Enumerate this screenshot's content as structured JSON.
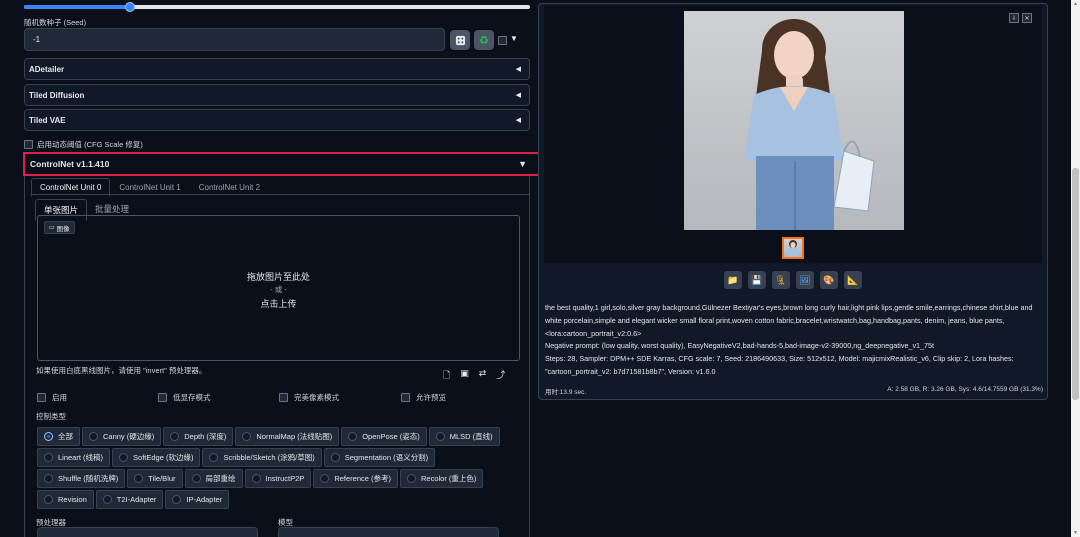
{
  "slider": {
    "fraction": 0.21
  },
  "seed": {
    "label": "随机数种子 (Seed)",
    "value": "-1",
    "dice_icon": "dice-icon",
    "recycle_icon": "recycle-icon",
    "extra_caret": "▼"
  },
  "accordions": [
    {
      "label": "ADetailer",
      "caret": "◀"
    },
    {
      "label": "Tiled Diffusion",
      "caret": "◀"
    },
    {
      "label": "Tiled VAE",
      "caret": "◀"
    }
  ],
  "dynamic_threshold": {
    "label": "启用动态阈值 (CFG Scale 修复)"
  },
  "controlnet": {
    "title": "ControlNet v1.1.410",
    "caret": "▼",
    "highlight_color": "#e11d48",
    "tabs": [
      "ControlNet Unit 0",
      "ControlNet Unit 1",
      "ControlNet Unit 2"
    ],
    "subtabs": [
      "单张图片",
      "批量处理"
    ],
    "image_badge": "图像",
    "drop_main": "拖放图片至此处",
    "drop_or": "- 或 -",
    "drop_upload": "点击上传",
    "hint": "如果使用白底黑线图片，请使用 \"invert\" 预处理器。",
    "options": [
      "启用",
      "低显存模式",
      "完美像素模式",
      "允许预览"
    ],
    "control_type_label": "控制类型",
    "control_types": [
      [
        "全部",
        "Canny (硬边缘)",
        "Depth (深度)",
        "NormalMap (法线贴图)",
        "OpenPose (姿态)",
        "MLSD (直线)"
      ],
      [
        "Lineart (线稿)",
        "SoftEdge (软边缘)",
        "Scribble/Sketch (涂鸦/草图)",
        "Segmentation (语义分割)"
      ],
      [
        "Shuffle (随机洗牌)",
        "Tile/Blur",
        "局部重绘",
        "InstructP2P",
        "Reference (参考)",
        "Recolor (重上色)"
      ],
      [
        "Revision",
        "T2I-Adapter",
        "IP-Adapter"
      ]
    ],
    "selected_control_type": "全部",
    "preprocessor_label": "预处理器",
    "model_label": "模型"
  },
  "output": {
    "prompt": "the best quality,1 girl,solo,silver gray background,Gülnezer Bextiyar's eyes,brown long curly hair,light pink lips,gentle smile,earrings,chinese shirt,blue and white porcelain,simple and elegant wicker small floral print,woven cotton fabric,bracelet,wristwatch,bag,handbag,pants, denim, jeans, blue pants, <lora:cartoon_portrait_v2:0.6>",
    "negative": "Negative prompt: (low quality, worst quality), EasyNegativeV2,bad-hands-5,bad-image-v2-39000,ng_deepnegative_v1_75t",
    "params": "Steps: 28, Sampler: DPM++ SDE Karras, CFG scale: 7, Seed: 2186490633, Size: 512x512, Model: majicmixRealistic_v6, Clip skip: 2, Lora hashes: \"cartoon_portrait_v2: b7d71581b8b7\", Version: v1.6.0",
    "time": "用时:13.9 sec.",
    "memory": "A: 2.58 GB, R: 3.26 GB, Sys: 4.6/14.7559 GB (31.3%)",
    "action_icons": [
      "folder-icon",
      "save-icon",
      "zip-icon",
      "image-icon",
      "palette-icon",
      "ruler-icon"
    ]
  }
}
